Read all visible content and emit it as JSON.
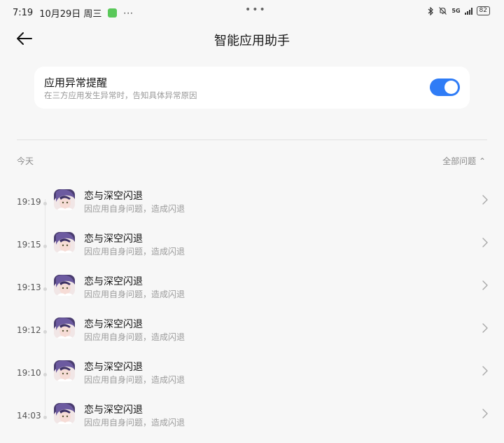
{
  "status_bar": {
    "time": "7:19",
    "date": "10月29日 周三",
    "more": "···",
    "network": "5G",
    "battery": "82"
  },
  "header": {
    "title": "智能应用助手"
  },
  "setting": {
    "title": "应用异常提醒",
    "subtitle": "在三方应用发生异常时，告知具体异常原因",
    "enabled": true
  },
  "list": {
    "section_label": "今天",
    "filter_label": "全部问题 ⌃",
    "items": [
      {
        "time": "19:19",
        "title": "恋与深空闪退",
        "subtitle": "因应用自身问题，造成闪退"
      },
      {
        "time": "19:15",
        "title": "恋与深空闪退",
        "subtitle": "因应用自身问题，造成闪退"
      },
      {
        "time": "19:13",
        "title": "恋与深空闪退",
        "subtitle": "因应用自身问题，造成闪退"
      },
      {
        "time": "19:12",
        "title": "恋与深空闪退",
        "subtitle": "因应用自身问题，造成闪退"
      },
      {
        "time": "19:10",
        "title": "恋与深空闪退",
        "subtitle": "因应用自身问题，造成闪退"
      },
      {
        "time": "14:03",
        "title": "恋与深空闪退",
        "subtitle": "因应用自身问题，造成闪退"
      }
    ]
  },
  "colors": {
    "accent": "#2f7cf6",
    "background": "#f7f7f7"
  }
}
